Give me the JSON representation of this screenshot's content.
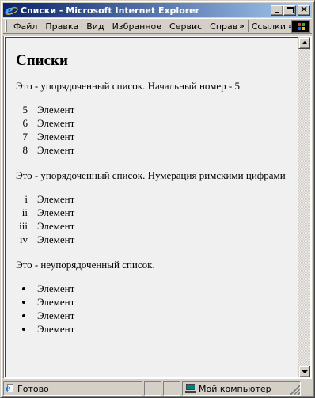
{
  "window": {
    "title": "Списки - Microsoft Internet Explorer"
  },
  "menu": {
    "items": [
      "Файл",
      "Правка",
      "Вид",
      "Избранное",
      "Сервис",
      "Справ"
    ],
    "more_chevron": "»",
    "links_label": "Ссылки",
    "links_chevron": "»"
  },
  "page": {
    "heading": "Списки",
    "ordered_intro": "Это - упорядоченный список. Начальный номер - 5",
    "ordered_items": [
      {
        "num": "5",
        "text": "Элемент"
      },
      {
        "num": "6",
        "text": "Элемент"
      },
      {
        "num": "7",
        "text": "Элемент"
      },
      {
        "num": "8",
        "text": "Элемент"
      }
    ],
    "roman_intro": "Это - упорядоченный список. Нумерация римскими цифрами",
    "roman_items": [
      {
        "num": "i",
        "text": "Элемент"
      },
      {
        "num": "ii",
        "text": "Элемент"
      },
      {
        "num": "iii",
        "text": "Элемент"
      },
      {
        "num": "iv",
        "text": "Элемент"
      }
    ],
    "unordered_intro": "Это - неупорядоченный список.",
    "unordered_items": [
      "Элемент",
      "Элемент",
      "Элемент",
      "Элемент"
    ]
  },
  "status": {
    "text": "Готово",
    "zone": "Мой компьютер"
  },
  "colors": {
    "titlebar_start": "#0a246a",
    "titlebar_end": "#a6caf0",
    "chrome": "#d4d0c8",
    "page_background": "#f0f0f0"
  }
}
